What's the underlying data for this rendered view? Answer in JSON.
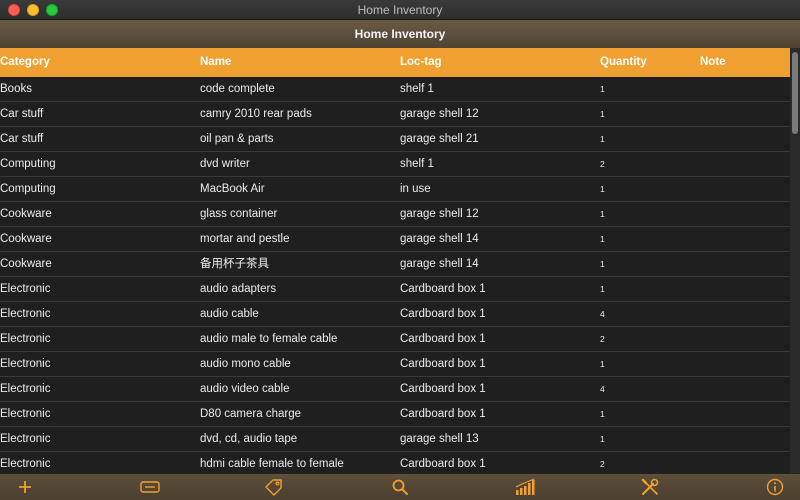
{
  "window": {
    "title": "Home Inventory"
  },
  "header": {
    "title": "Home Inventory"
  },
  "columns": {
    "category": "Category",
    "name": "Name",
    "loctag": "Loc-tag",
    "quantity": "Quantity",
    "note": "Note"
  },
  "rows": [
    {
      "category": "Books",
      "name": "code complete",
      "loctag": "shelf 1",
      "quantity": "1",
      "note": ""
    },
    {
      "category": "Car stuff",
      "name": "camry 2010 rear pads",
      "loctag": "garage shell 12",
      "quantity": "1",
      "note": ""
    },
    {
      "category": "Car stuff",
      "name": "oil pan & parts",
      "loctag": "garage shell 21",
      "quantity": "1",
      "note": ""
    },
    {
      "category": "Computing",
      "name": "dvd writer",
      "loctag": "shelf 1",
      "quantity": "2",
      "note": ""
    },
    {
      "category": "Computing",
      "name": "MacBook Air",
      "loctag": "in use",
      "quantity": "1",
      "note": ""
    },
    {
      "category": "Cookware",
      "name": "glass container",
      "loctag": "garage shell 12",
      "quantity": "1",
      "note": ""
    },
    {
      "category": "Cookware",
      "name": "mortar and pestle",
      "loctag": "garage shell 14",
      "quantity": "1",
      "note": ""
    },
    {
      "category": "Cookware",
      "name": "备用杯子茶具",
      "loctag": "garage shell 14",
      "quantity": "1",
      "note": ""
    },
    {
      "category": "Electronic",
      "name": "audio adapters",
      "loctag": "Cardboard box 1",
      "quantity": "1",
      "note": ""
    },
    {
      "category": "Electronic",
      "name": "audio cable",
      "loctag": "Cardboard box 1",
      "quantity": "4",
      "note": ""
    },
    {
      "category": "Electronic",
      "name": "audio male to female cable",
      "loctag": "Cardboard box 1",
      "quantity": "2",
      "note": ""
    },
    {
      "category": "Electronic",
      "name": "audio mono cable",
      "loctag": "Cardboard box 1",
      "quantity": "1",
      "note": ""
    },
    {
      "category": "Electronic",
      "name": "audio video cable",
      "loctag": "Cardboard box 1",
      "quantity": "4",
      "note": ""
    },
    {
      "category": "Electronic",
      "name": "D80 camera charge",
      "loctag": "Cardboard box 1",
      "quantity": "1",
      "note": ""
    },
    {
      "category": "Electronic",
      "name": "dvd, cd, audio tape",
      "loctag": "garage shell 13",
      "quantity": "1",
      "note": ""
    },
    {
      "category": "Electronic",
      "name": "hdmi cable female to female",
      "loctag": "Cardboard box 1",
      "quantity": "2",
      "note": ""
    }
  ],
  "toolbar": {
    "icons": [
      "plus-icon",
      "list-icon",
      "tag-icon",
      "search-icon",
      "chart-icon",
      "tools-icon",
      "info-icon"
    ],
    "accent": "#f0a030"
  },
  "colors": {
    "header_bar": "#f0a030",
    "background": "#1f1f1f",
    "toolbar": "#4f4333"
  }
}
